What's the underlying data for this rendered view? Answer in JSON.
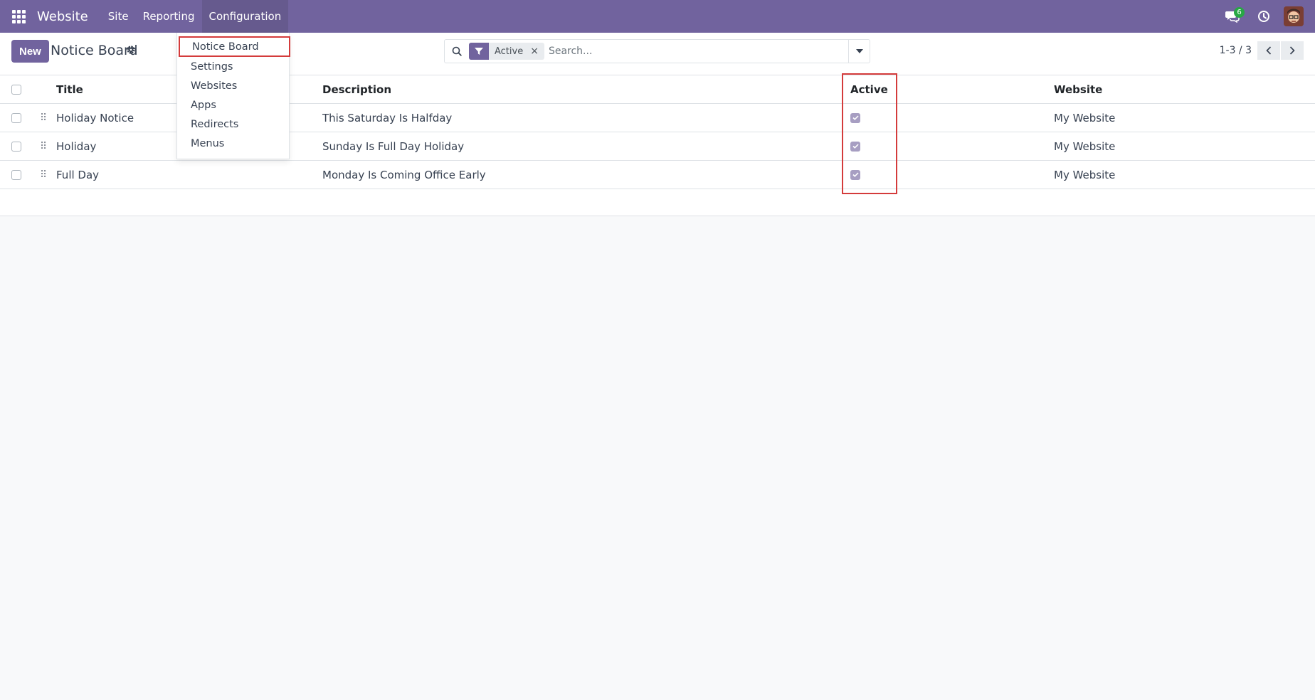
{
  "navbar": {
    "brand": "Website",
    "menus": [
      "Site",
      "Reporting",
      "Configuration"
    ],
    "active_menu": "Configuration",
    "messages_count": "6",
    "colors": {
      "bar": "#71639e",
      "badge": "#28a745"
    }
  },
  "control_panel": {
    "new_label": "New",
    "title": "Notice Board",
    "search": {
      "facet_value": "Active",
      "facet_remove": "×",
      "placeholder": "Search..."
    },
    "pager": "1-3 / 3"
  },
  "dropdown": {
    "items": [
      "Notice Board",
      "Settings",
      "Websites",
      "Apps",
      "Redirects",
      "Menus"
    ],
    "highlighted": "Notice Board"
  },
  "table": {
    "columns": [
      "Title",
      "Description",
      "Active",
      "Website"
    ],
    "rows": [
      {
        "title": "Holiday Notice",
        "description": "This Saturday Is Halfday",
        "active": true,
        "website": "My Website"
      },
      {
        "title": "Holiday",
        "description": "Sunday Is Full Day Holiday",
        "active": true,
        "website": "My Website"
      },
      {
        "title": "Full Day",
        "description": "Monday Is Coming Office Early",
        "active": true,
        "website": "My Website"
      }
    ]
  },
  "annotation": {
    "highlight_color": "#d43b3b"
  }
}
